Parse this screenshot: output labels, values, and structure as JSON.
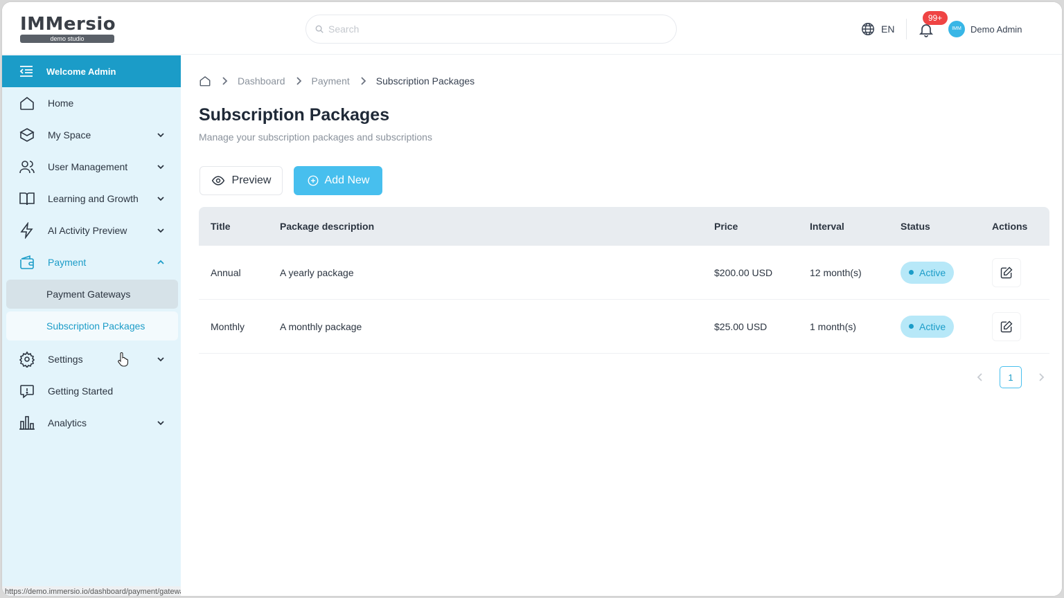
{
  "header": {
    "logo_text": "IMMersio",
    "logo_tagline": "demo studio",
    "search_placeholder": "Search",
    "language": "EN",
    "notification_count": "99+",
    "avatar_text": "IMM",
    "user_name": "Demo Admin"
  },
  "sidebar": {
    "welcome": "Welcome Admin",
    "items": [
      {
        "label": "Home"
      },
      {
        "label": "My Space"
      },
      {
        "label": "User Management"
      },
      {
        "label": "Learning and Growth"
      },
      {
        "label": "AI Activity Preview"
      },
      {
        "label": "Payment"
      },
      {
        "label": "Settings"
      },
      {
        "label": "Getting Started"
      },
      {
        "label": "Analytics"
      }
    ],
    "payment_sub": [
      {
        "label": "Payment Gateways"
      },
      {
        "label": "Subscription Packages"
      }
    ]
  },
  "breadcrumb": {
    "items": [
      "Dashboard",
      "Payment",
      "Subscription Packages"
    ]
  },
  "page": {
    "title": "Subscription Packages",
    "subtitle": "Manage your subscription packages and subscriptions",
    "preview_label": "Preview",
    "add_label": "Add New"
  },
  "table": {
    "headers": [
      "Title",
      "Package description",
      "Price",
      "Interval",
      "Status",
      "Actions"
    ],
    "rows": [
      {
        "title": "Annual",
        "description": "A yearly package",
        "price": "$200.00 USD",
        "interval": "12 month(s)",
        "status": "Active"
      },
      {
        "title": "Monthly",
        "description": "A monthly package",
        "price": "$25.00 USD",
        "interval": "1 month(s)",
        "status": "Active"
      }
    ]
  },
  "pagination": {
    "current": "1"
  },
  "status_bar_url": "https://demo.immersio.io/dashboard/payment/gateways",
  "colors": {
    "accent": "#1b9cc8",
    "button": "#47bfee",
    "sidebar_bg": "#e3f4fb",
    "badge": "#ef4444"
  }
}
